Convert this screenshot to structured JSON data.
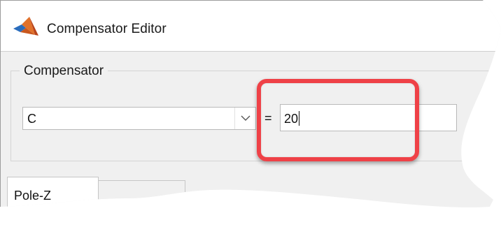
{
  "window": {
    "title": "Compensator Editor",
    "app_icon": "matlab-logo-icon"
  },
  "compensator": {
    "group_label": "Compensator",
    "selected": "C",
    "dropdown_icon": "chevron-down-icon",
    "equals": "=",
    "value": "20"
  },
  "tabs": [
    {
      "label": "Pole-Z"
    }
  ],
  "annotation": {
    "color": "#ef4147"
  }
}
